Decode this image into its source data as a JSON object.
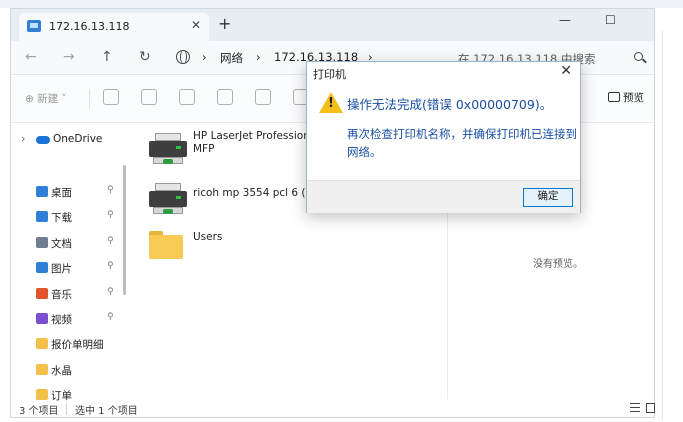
{
  "window": {
    "tab_title": "172.16.13.118",
    "tab_close": "✕",
    "new_tab": "+",
    "minimize": "—",
    "maximize": "☐"
  },
  "navigation": {
    "back": "←",
    "forward": "→",
    "up": "↑",
    "refresh": "↻",
    "breadcrumb": [
      "网络",
      "172.16.13.118"
    ],
    "separator": "›",
    "search_placeholder": "在 172.16.13.118 中搜索"
  },
  "toolbar": {
    "new_label": "⊕ 新建 ˅",
    "preview_label": "预览"
  },
  "sidebar": {
    "onedrive": "OneDrive",
    "items": [
      {
        "label": "桌面",
        "icon": "desktop-icon",
        "color": "#2f7fd6",
        "pinned": true
      },
      {
        "label": "下载",
        "icon": "download-icon",
        "color": "#2f7fd6",
        "pinned": true
      },
      {
        "label": "文档",
        "icon": "documents-icon",
        "color": "#6f7f91",
        "pinned": true
      },
      {
        "label": "图片",
        "icon": "pictures-icon",
        "color": "#2f7fd6",
        "pinned": true
      },
      {
        "label": "音乐",
        "icon": "music-icon",
        "color": "#e0532b",
        "pinned": true
      },
      {
        "label": "视频",
        "icon": "video-icon",
        "color": "#7a4fd0",
        "pinned": true
      },
      {
        "label": "报价单明细",
        "icon": "folder-icon",
        "color": "#f3c049",
        "pinned": false
      },
      {
        "label": "水晶",
        "icon": "folder-icon",
        "color": "#f3c049",
        "pinned": false
      },
      {
        "label": "订单",
        "icon": "folder-icon",
        "color": "#f3c049",
        "pinned": false
      }
    ],
    "pin_glyph": "📌"
  },
  "files": [
    {
      "name": "HP LaserJet Professional MFP",
      "type": "printer"
    },
    {
      "name": "ricoh mp 3554 pcl 6 (副本",
      "type": "printer"
    },
    {
      "name": "Users",
      "type": "folder"
    }
  ],
  "details_pane": {
    "no_preview": "没有预览。"
  },
  "status": {
    "item_count": "3 个项目",
    "selected": "选中 1 个项目"
  },
  "dialog": {
    "title": "打印机",
    "close": "✕",
    "main_message": "操作无法完成(错误 0x00000709)。",
    "detail_message": "再次检查打印机名称，并确保打印机已连接到网络。",
    "ok_button": "确定"
  },
  "colors": {
    "accent": "#0078d7",
    "dialog_text": "#1a4fa3",
    "warning": "#f3c019"
  }
}
